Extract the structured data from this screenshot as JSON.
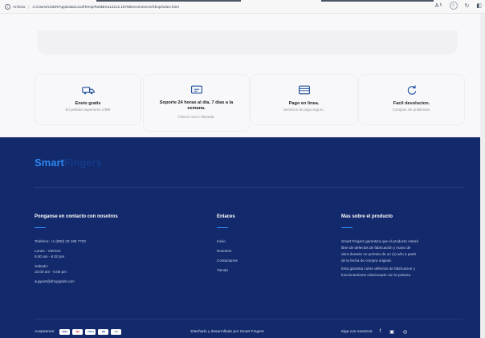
{
  "browser": {
    "info_label": "Archivo",
    "url": "C:/Users/USER/AppData/Local/Temp/Rar$EXa12212.16768/ecommerce/Shop/index.html",
    "icons": [
      "read-aloud-icon",
      "favorite-star-icon",
      "sync-icon",
      "split-screen-icon"
    ]
  },
  "features": [
    {
      "icon": "truck-icon",
      "title": "Envio gratis",
      "subtitle": "En pedidos superiores a $99"
    },
    {
      "icon": "support-icon",
      "title": "Soporte 24 horas al dia, 7 dias a la semana.",
      "subtitle": "Chat en vivo o llamada."
    },
    {
      "icon": "card-icon",
      "title": "Pago en linea.",
      "subtitle": "Servicios de pago seguro."
    },
    {
      "icon": "refresh-icon",
      "title": "Facil devolucion.",
      "subtitle": "Compras sin problemas."
    }
  ],
  "footer": {
    "brand_part1": "Smart",
    "brand_part2": "Fingers",
    "contact": {
      "heading": "Ponganse en contacto con nosotros",
      "phone": "Telefono: +1 (900) 33 169 7720",
      "weekdays_label": "Lunes - Viernes:",
      "weekdays_hours": "9.00 am - 8.00 pm",
      "saturday_label": "Sabado:",
      "saturday_hours": "10.00 am - 6.00 pm",
      "email": "support@shopgrids.com"
    },
    "links": {
      "heading": "Enlaces",
      "items": [
        "Inicio",
        "Nosotros",
        "Contactanos",
        "Tienda"
      ]
    },
    "about": {
      "heading": "Mas sobre el producto",
      "para1_line1": "Smart Fingers garantiza que el producto estará",
      "para1_line2": "libre de defectos de fabricación y mano de",
      "para1_line3": "obra durante un periodo de un (1) año a partir",
      "para1_line4": "de la fecha de compra original.",
      "para2_line1": "Esta garantia cubre defectos de fabricacion y",
      "para2_line2": "funcionamiento relacionado con la pulsera."
    },
    "bottom": {
      "accept_label": "Aceptamos:",
      "cards": [
        "VISA",
        "MC",
        "AMEX",
        "PP",
        "CC"
      ],
      "credit": "Diseñado y desarrollado por Smart Fingers",
      "follow_label": "Siga con nosotros:",
      "social": [
        "facebook-icon",
        "twitter-icon",
        "instagram-icon"
      ]
    }
  },
  "colors": {
    "footer_bg": "#12296b",
    "brand_accent": "#2e86f0",
    "brand_dark": "#143a88"
  }
}
